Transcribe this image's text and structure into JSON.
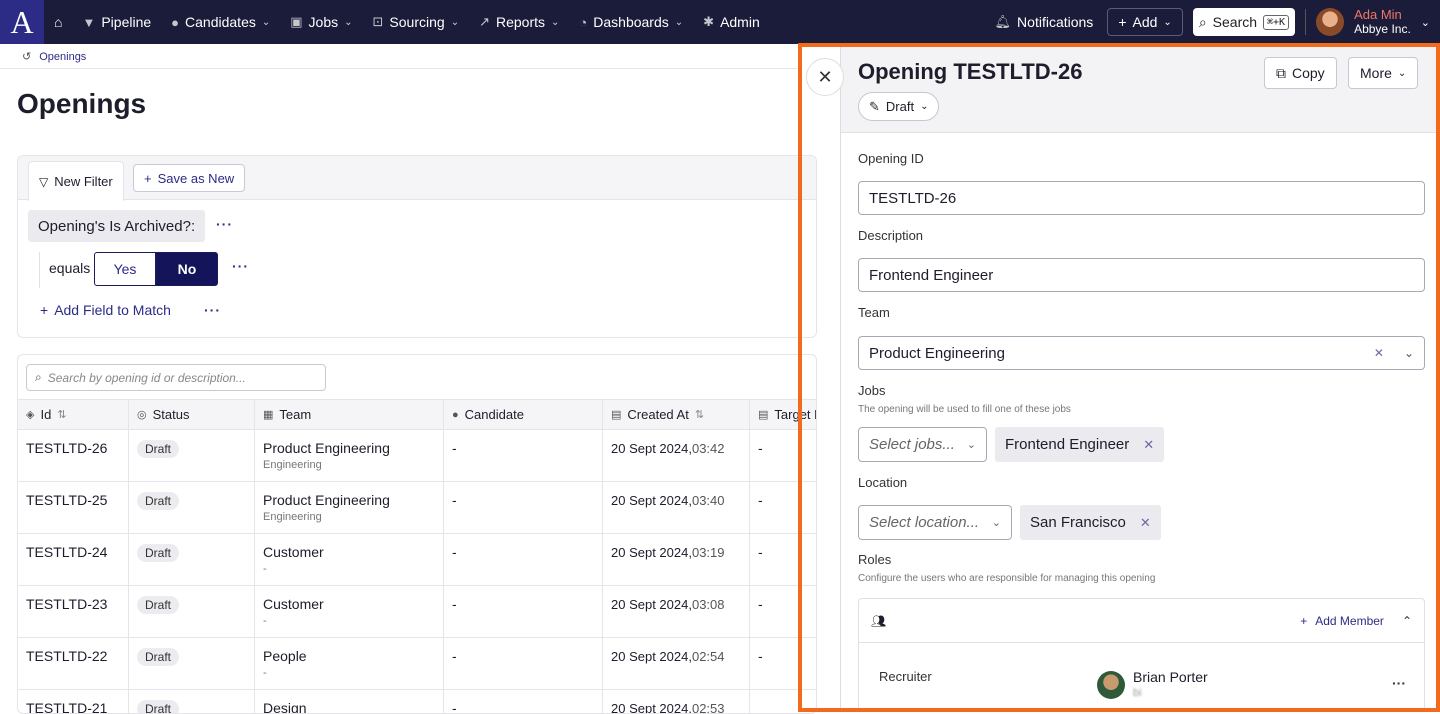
{
  "nav": {
    "logo": "A",
    "items": [
      {
        "label": "Pipeline",
        "icon": "filter-icon",
        "chevron": false
      },
      {
        "label": "Candidates",
        "icon": "people-icon",
        "chevron": true
      },
      {
        "label": "Jobs",
        "icon": "briefcase-icon",
        "chevron": true
      },
      {
        "label": "Sourcing",
        "icon": "sourcing-icon",
        "chevron": true
      },
      {
        "label": "Reports",
        "icon": "chart-icon",
        "chevron": true
      },
      {
        "label": "Dashboards",
        "icon": "dashboard-icon",
        "chevron": true
      },
      {
        "label": "Admin",
        "icon": "gear-icon",
        "chevron": false
      }
    ],
    "notifications": "Notifications",
    "add": "Add",
    "search": "Search",
    "search_shortcut": "⌘+K",
    "user_name": "Ada Min",
    "user_org": "Abbye Inc."
  },
  "breadcrumb": "Openings",
  "page_title": "Openings",
  "filter": {
    "tab_new_filter": "New Filter",
    "save_as_new": "Save as New",
    "field": "Opening's Is Archived?:",
    "operator": "equals",
    "yes": "Yes",
    "no": "No",
    "selected": "No",
    "add_field": "Add Field to Match",
    "more": "···"
  },
  "table": {
    "search_placeholder": "Search by opening id or description...",
    "columns": [
      "Id",
      "Status",
      "Team",
      "Candidate",
      "Created At",
      "Target Hire"
    ],
    "rows": [
      {
        "id": "TESTLTD-26",
        "status": "Draft",
        "team": "Product Engineering",
        "team_sub": "Engineering",
        "candidate": "-",
        "date": "20 Sept 2024,",
        "time": "03:42",
        "target": "-"
      },
      {
        "id": "TESTLTD-25",
        "status": "Draft",
        "team": "Product Engineering",
        "team_sub": "Engineering",
        "candidate": "-",
        "date": "20 Sept 2024,",
        "time": "03:40",
        "target": "-"
      },
      {
        "id": "TESTLTD-24",
        "status": "Draft",
        "team": "Customer",
        "team_sub": "-",
        "candidate": "-",
        "date": "20 Sept 2024,",
        "time": "03:19",
        "target": "-"
      },
      {
        "id": "TESTLTD-23",
        "status": "Draft",
        "team": "Customer",
        "team_sub": "-",
        "candidate": "-",
        "date": "20 Sept 2024,",
        "time": "03:08",
        "target": "-"
      },
      {
        "id": "TESTLTD-22",
        "status": "Draft",
        "team": "People",
        "team_sub": "-",
        "candidate": "-",
        "date": "20 Sept 2024,",
        "time": "02:54",
        "target": "-"
      },
      {
        "id": "TESTLTD-21",
        "status": "Draft",
        "team": "Design",
        "team_sub": "",
        "candidate": "-",
        "date": "20 Sept 2024,",
        "time": "02:53",
        "target": ""
      }
    ]
  },
  "drawer": {
    "title": "Opening TESTLTD-26",
    "status": "Draft",
    "copy": "Copy",
    "more": "More",
    "opening_id_label": "Opening ID",
    "opening_id_value": "TESTLTD-26",
    "description_label": "Description",
    "description_value": "Frontend Engineer",
    "team_label": "Team",
    "team_value": "Product Engineering",
    "jobs_label": "Jobs",
    "jobs_hint": "The opening will be used to fill one of these jobs",
    "jobs_placeholder": "Select jobs...",
    "jobs_chip": "Frontend Engineer",
    "location_label": "Location",
    "location_placeholder": "Select location...",
    "location_chip": "San Francisco",
    "roles_label": "Roles",
    "roles_hint": "Configure the users who are responsible for managing this opening",
    "add_member": "Add Member",
    "role_name": "Recruiter",
    "member_name": "Brian Porter",
    "member_email": "bi          "
  },
  "colors": {
    "nav_bg": "#1b1b3a",
    "accent": "#2c2c86",
    "highlight_frame": "#f26b1d"
  }
}
